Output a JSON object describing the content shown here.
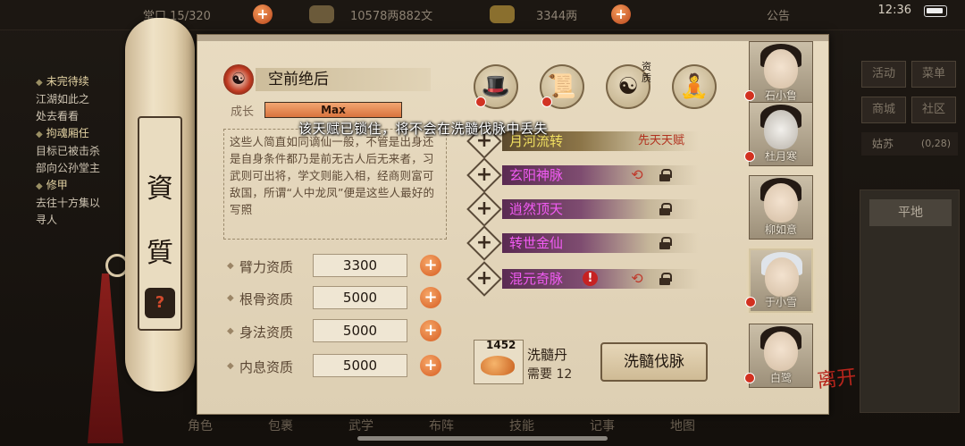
{
  "topbar": {
    "capacity_label": "堂口",
    "capacity_value": "15/320",
    "money": "10578两882文",
    "gold": "3344两",
    "notice": "公告",
    "time": "12:36"
  },
  "quests": [
    {
      "title": "未完待续",
      "lines": [
        "江湖如此之",
        "处去看看"
      ]
    },
    {
      "title": "拘魂厢任",
      "lines": [
        "目标已被击杀",
        "部向公孙堂主"
      ]
    },
    {
      "title": "修甲",
      "lines": [
        "去往十方集以",
        "寻人"
      ]
    }
  ],
  "right_menu": {
    "buttons": [
      "活动",
      "菜单",
      "商城",
      "社区"
    ],
    "location": "姑苏",
    "coords": "(0,28)",
    "option": "平地"
  },
  "bottom_bar": [
    "角色",
    "包裹",
    "武学",
    "布阵",
    "技能",
    "记事",
    "地图"
  ],
  "scroll": {
    "title_top": "資",
    "title_bottom": "質",
    "help": "?"
  },
  "talent": {
    "icon": "yin-yang-icon",
    "name": "空前绝后",
    "growth_label": "成长",
    "growth_value": "Max",
    "growth_fraction": 1.0,
    "description": "这些人简直如同谪仙一般，不管是出身还是自身条件都乃是前无古人后无来者，习武则可出将，学文则能入相，经商则富可敌国，所谓“人中龙凤”便是这些人最好的写照"
  },
  "stats": [
    {
      "label": "臂力资质",
      "value": "3300"
    },
    {
      "label": "根骨资质",
      "value": "5000"
    },
    {
      "label": "身法资质",
      "value": "5000"
    },
    {
      "label": "内息资质",
      "value": "5000"
    }
  ],
  "equipment": [
    {
      "icon": "bamboo-hat-icon",
      "badge": true
    },
    {
      "icon": "book-icon",
      "badge": true
    },
    {
      "icon": "compass-icon",
      "badge": false,
      "tag": "资质"
    },
    {
      "icon": "meridian-figure-icon",
      "badge": false
    }
  ],
  "tooltip": "该天赋已锁住，将不会在洗髓伐脉中丢失",
  "meridians": [
    {
      "name": "月河流转",
      "extra": "先天天赋",
      "style": "gold",
      "cycle": false,
      "warn": false,
      "lock": false
    },
    {
      "name": "玄阳神脉",
      "extra": "",
      "style": "purple",
      "cycle": true,
      "warn": false,
      "lock": true
    },
    {
      "name": "逍然顶天",
      "extra": "",
      "style": "purple",
      "cycle": false,
      "warn": false,
      "lock": true
    },
    {
      "name": "转世金仙",
      "extra": "",
      "style": "purple",
      "cycle": false,
      "warn": false,
      "lock": true
    },
    {
      "name": "混元奇脉",
      "extra": "",
      "style": "purple",
      "cycle": true,
      "warn": true,
      "lock": true
    }
  ],
  "pill": {
    "count": "1452",
    "name": "洗髓丹",
    "need": "需要 12"
  },
  "wash_button": "洗髓伐脉",
  "characters": [
    {
      "name": "石小鲁",
      "dot": true,
      "selected": false
    },
    {
      "name": "杜月寒",
      "dot": true,
      "selected": false
    },
    {
      "name": "柳如意",
      "dot": false,
      "selected": false
    },
    {
      "name": "于小雪",
      "dot": true,
      "selected": true
    },
    {
      "name": "白鹭",
      "dot": true,
      "selected": false
    }
  ],
  "leave_button": "离开",
  "colors": {
    "purple_text": "#f15bf3",
    "gold_text": "#f1e061",
    "orange_plus": "#d65d22",
    "paper": "#e3d5ba"
  }
}
